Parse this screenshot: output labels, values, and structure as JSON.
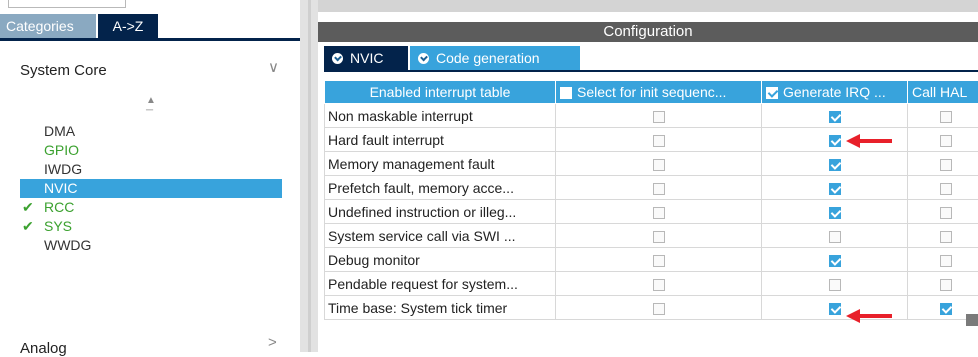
{
  "left_panel": {
    "tabs": {
      "categories": "Categories",
      "az": "A->Z"
    },
    "group": {
      "title": "System Core"
    },
    "items": [
      {
        "label": "DMA",
        "state": "normal"
      },
      {
        "label": "GPIO",
        "state": "green"
      },
      {
        "label": "IWDG",
        "state": "normal"
      },
      {
        "label": "NVIC",
        "state": "selected"
      },
      {
        "label": "RCC",
        "state": "checked"
      },
      {
        "label": "SYS",
        "state": "checked"
      },
      {
        "label": "WWDG",
        "state": "normal"
      }
    ],
    "next_group": {
      "title": "Analog"
    }
  },
  "config": {
    "header": "Configuration",
    "tabs": [
      {
        "label": "NVIC",
        "active": false
      },
      {
        "label": "Code generation",
        "active": true
      }
    ],
    "columns": [
      "Enabled interrupt table",
      "Select for init sequenc...",
      "Generate IRQ ...",
      "Call HAL"
    ],
    "column_checked": [
      false,
      false,
      true,
      false
    ],
    "rows": [
      {
        "name": "Non maskable interrupt",
        "init": false,
        "irq": true,
        "hal": false
      },
      {
        "name": "Hard fault interrupt",
        "init": false,
        "irq": true,
        "hal": false
      },
      {
        "name": "Memory management fault",
        "init": false,
        "irq": true,
        "hal": false
      },
      {
        "name": "Prefetch fault, memory acce...",
        "init": false,
        "irq": true,
        "hal": false
      },
      {
        "name": "Undefined instruction or illeg...",
        "init": false,
        "irq": true,
        "hal": false
      },
      {
        "name": "System service call via SWI ...",
        "init": false,
        "irq": false,
        "hal": false
      },
      {
        "name": "Debug monitor",
        "init": false,
        "irq": true,
        "hal": false
      },
      {
        "name": "Pendable request for system...",
        "init": false,
        "irq": false,
        "hal": false
      },
      {
        "name": "Time base: System tick timer",
        "init": false,
        "irq": true,
        "hal": true
      }
    ]
  },
  "colors": {
    "accent": "#38a3dc",
    "dark_navy": "#03234b",
    "header_gray": "#5c5c5c",
    "arrow_red": "#e8202a",
    "enabled_green": "#3ba12f"
  }
}
